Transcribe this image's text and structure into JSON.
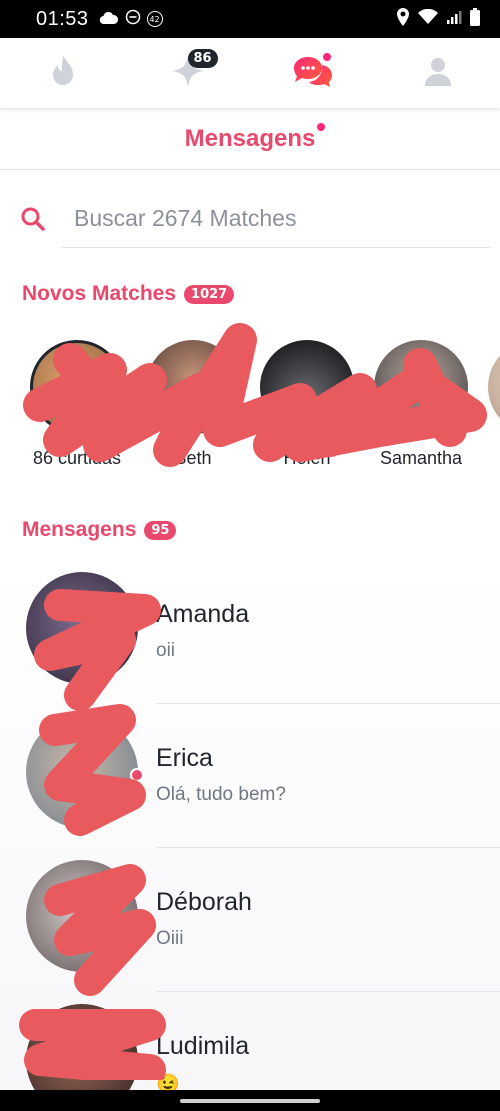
{
  "status_bar": {
    "time": "01:53",
    "badge": "42"
  },
  "nav": {
    "icons": [
      "flame-icon",
      "sparkle-icon",
      "chat-bubbles-icon",
      "profile-icon"
    ],
    "sparkle_count": "86"
  },
  "header": {
    "title": "Mensagens"
  },
  "search": {
    "placeholder": "Buscar 2674 Matches"
  },
  "new_matches": {
    "label": "Novos Matches",
    "count": "1027",
    "items": [
      {
        "name": "86 curtidas"
      },
      {
        "name": "Beth"
      },
      {
        "name": "Helen"
      },
      {
        "name": "Samantha"
      }
    ]
  },
  "messages": {
    "label": "Mensagens",
    "count": "95",
    "items": [
      {
        "name": "Amanda",
        "preview": "oii",
        "unread": false
      },
      {
        "name": "Erica",
        "preview": "Olá, tudo bem?",
        "unread": true
      },
      {
        "name": "Déborah",
        "preview": "Oiii",
        "unread": false
      },
      {
        "name": "Ludimila",
        "preview": "😉",
        "unread": false
      }
    ]
  },
  "colors": {
    "accent": "#e8496c",
    "brand": "#fd267a",
    "text": "#21262e",
    "muted": "#6f7782",
    "redaction": "#e85a5e"
  }
}
